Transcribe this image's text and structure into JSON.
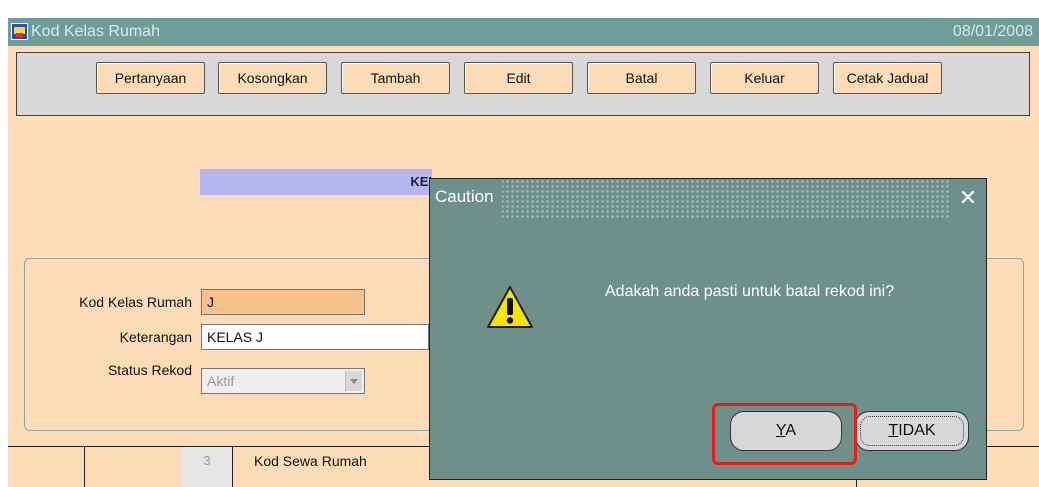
{
  "window": {
    "title": "Kod Kelas Rumah",
    "date": "08/01/2008"
  },
  "toolbar": {
    "buttons": [
      {
        "label": "Pertanyaan"
      },
      {
        "label": "Kosongkan"
      },
      {
        "label": "Tambah"
      },
      {
        "label": "Edit"
      },
      {
        "label": "Batal"
      },
      {
        "label": "Keluar"
      },
      {
        "label": "Cetak Jadual"
      }
    ]
  },
  "section": {
    "heading_partial": "KEI"
  },
  "form": {
    "kod_kelas_label": "Kod Kelas Rumah",
    "kod_kelas_value": "J",
    "keterangan_label": "Keterangan",
    "keterangan_value": "KELAS J",
    "status_label": "Status Rekod",
    "status_value": "Aktif"
  },
  "table": {
    "row_number": "3",
    "row_text": "Kod Sewa Rumah"
  },
  "dialog": {
    "title": "Caution",
    "close_glyph": "✕",
    "message": "Adakah anda pasti untuk batal rekod ini?",
    "yes_label_rest": "A",
    "yes_label_mnemonic": "Y",
    "no_label_rest": "IDAK",
    "no_label_mnemonic": "T"
  },
  "colors": {
    "titlebar": "#6f9d98",
    "window_bg": "#fcdcb8",
    "dialog_bg": "#6f8f8a",
    "highlight": "#e02020",
    "active_field": "#f8c28e"
  },
  "icons": {
    "app": "form-app-icon",
    "warning": "warning-icon",
    "close": "close-icon",
    "dropdown": "chevron-down-icon"
  }
}
